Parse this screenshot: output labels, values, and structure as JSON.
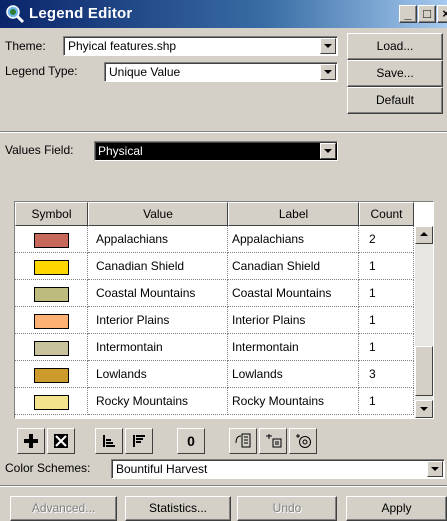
{
  "window": {
    "title": "Legend Editor",
    "minimize_glyph": "_",
    "maximize_glyph": "□",
    "close_glyph": "×"
  },
  "theme": {
    "label": "Theme:",
    "value": "Phyical features.shp"
  },
  "legend_type": {
    "label": "Legend Type:",
    "value": "Unique Value"
  },
  "buttons": {
    "load": "Load...",
    "save": "Save...",
    "default": "Default"
  },
  "values_field": {
    "label": "Values Field:",
    "value": "Physical"
  },
  "table": {
    "headers": [
      "Symbol",
      "Value",
      "Label",
      "Count"
    ],
    "rows": [
      {
        "color": "#c7685a",
        "value": "Appalachians",
        "label": "Appalachians",
        "count": "2"
      },
      {
        "color": "#ffd700",
        "value": "Canadian Shield",
        "label": "Canadian Shield",
        "count": "1"
      },
      {
        "color": "#bdbb7d",
        "value": "Coastal Mountains",
        "label": "Coastal Mountains",
        "count": "1"
      },
      {
        "color": "#ffb073",
        "value": "Interior Plains",
        "label": "Interior Plains",
        "count": "1"
      },
      {
        "color": "#c9c39d",
        "value": "Intermontain",
        "label": "Intermontain",
        "count": "1"
      },
      {
        "color": "#cd9a2c",
        "value": "Lowlands",
        "label": "Lowlands",
        "count": "3"
      },
      {
        "color": "#f2e38c",
        "value": "Rocky Mountains",
        "label": "Rocky Mountains",
        "count": "1"
      }
    ]
  },
  "toolbar": {
    "icons": [
      "add-icon",
      "delete-icon",
      "sort-ascending-icon",
      "sort-descending-icon",
      "null-value-icon",
      "promote-icon",
      "reverse-icon",
      "properties-icon"
    ],
    "null_text": "0"
  },
  "color_schemes": {
    "label": "Color Schemes:",
    "value": "Bountiful Harvest"
  },
  "bottom_buttons": {
    "advanced": "Advanced...",
    "statistics": "Statistics...",
    "undo": "Undo",
    "apply": "Apply"
  },
  "colors": {
    "title_bar_start": "#0a246a",
    "title_bar_end": "#a6caf0",
    "dialog_face": "#d4d0c8",
    "selection": "#000000"
  }
}
